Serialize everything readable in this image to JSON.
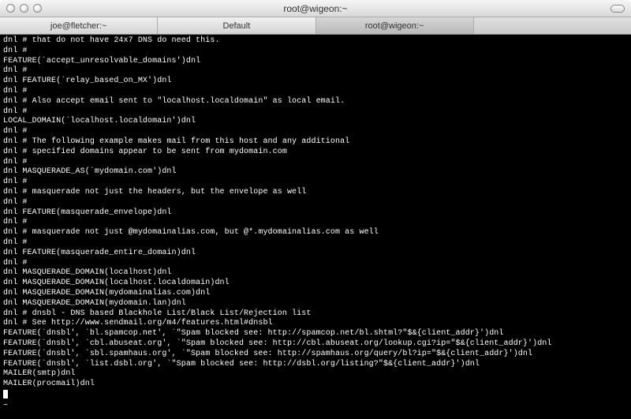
{
  "window": {
    "title": "root@wigeon:~"
  },
  "tabs": [
    {
      "label": "joe@fletcher:~",
      "active": false
    },
    {
      "label": "Default",
      "active": false
    },
    {
      "label": "root@wigeon:~",
      "active": true
    },
    {
      "label": "",
      "active": false
    }
  ],
  "terminal": {
    "lines": [
      "dnl # that do not have 24x7 DNS do need this.",
      "dnl #",
      "FEATURE(`accept_unresolvable_domains')dnl",
      "dnl #",
      "dnl FEATURE(`relay_based_on_MX')dnl",
      "dnl #",
      "dnl # Also accept email sent to \"localhost.localdomain\" as local email.",
      "dnl #",
      "LOCAL_DOMAIN(`localhost.localdomain')dnl",
      "dnl #",
      "dnl # The following example makes mail from this host and any additional",
      "dnl # specified domains appear to be sent from mydomain.com",
      "dnl #",
      "dnl MASQUERADE_AS(`mydomain.com')dnl",
      "dnl #",
      "dnl # masquerade not just the headers, but the envelope as well",
      "dnl #",
      "dnl FEATURE(masquerade_envelope)dnl",
      "dnl #",
      "dnl # masquerade not just @mydomainalias.com, but @*.mydomainalias.com as well",
      "dnl #",
      "dnl FEATURE(masquerade_entire_domain)dnl",
      "dnl #",
      "dnl MASQUERADE_DOMAIN(localhost)dnl",
      "dnl MASQUERADE_DOMAIN(localhost.localdomain)dnl",
      "dnl MASQUERADE_DOMAIN(mydomainalias.com)dnl",
      "dnl MASQUERADE_DOMAIN(mydomain.lan)dnl",
      "dnl # dnsbl - DNS based Blackhole List/Black List/Rejection list",
      "dnl # See http://www.sendmail.org/m4/features.html#dnsbl",
      "FEATURE(`dnsbl', `bl.spamcop.net', `\"Spam blocked see: http://spamcop.net/bl.shtml?\"$&{client_addr}')dnl",
      "FEATURE(`dnsbl', `cbl.abuseat.org', `\"Spam blocked see: http://cbl.abuseat.org/lookup.cgi?ip=\"$&{client_addr}')dnl",
      "FEATURE(`dnsbl', `sbl.spamhaus.org', `\"Spam blocked see: http://spamhaus.org/query/bl?ip=\"$&{client_addr}')dnl",
      "FEATURE(`dnsbl', `list.dsbl.org', `\"Spam blocked see: http://dsbl.org/listing?\"$&{client_addr}')dnl",
      "MAILER(smtp)dnl",
      "MAILER(procmail)dnl"
    ],
    "prompt_trailer": "~"
  }
}
